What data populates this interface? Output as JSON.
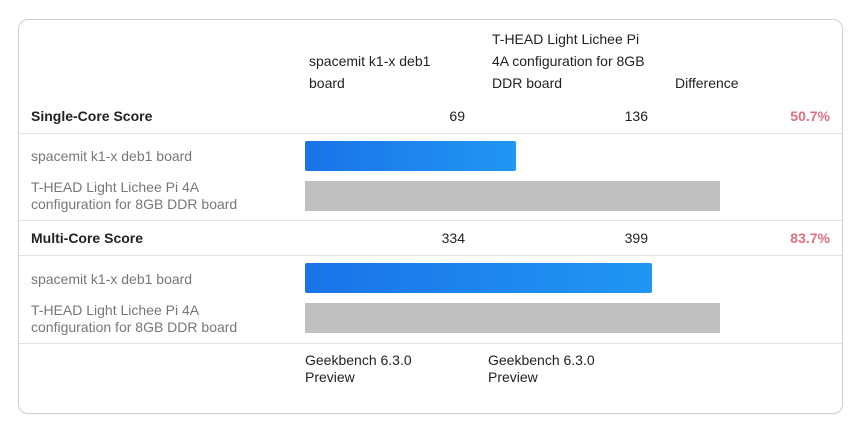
{
  "header": {
    "device_a": "spacemit k1-x deb1 board",
    "device_b": "T-HEAD Light Lichee Pi 4A configuration for 8GB DDR board",
    "difference": "Difference"
  },
  "chart_data": {
    "type": "bar",
    "orientation": "horizontal",
    "max_value": 399,
    "groups": [
      {
        "title": "Single-Core Score",
        "score_a": "69",
        "score_b": "136",
        "difference": "50.7%",
        "bars": [
          {
            "label": "spacemit k1-x deb1 board",
            "value": 69,
            "max": 136,
            "color": "#1a73e8"
          },
          {
            "label": "T-HEAD Light Lichee Pi 4A configuration for 8GB DDR board",
            "value": 136,
            "max": 136,
            "color": "#c0c0c0"
          }
        ]
      },
      {
        "title": "Multi-Core Score",
        "score_a": "334",
        "score_b": "399",
        "difference": "83.7%",
        "bars": [
          {
            "label": "spacemit k1-x deb1 board",
            "value": 334,
            "max": 399,
            "color": "#1a73e8"
          },
          {
            "label": "T-HEAD Light Lichee Pi 4A configuration for 8GB DDR board",
            "value": 399,
            "max": 399,
            "color": "#c0c0c0"
          }
        ]
      }
    ]
  },
  "footer": {
    "version_a": "Geekbench 6.3.0 Preview",
    "version_b": "Geekbench 6.3.0 Preview"
  },
  "colors": {
    "accent": "#1a73e8",
    "difference": "#e0707f",
    "reference_bar": "#c0c0c0"
  }
}
